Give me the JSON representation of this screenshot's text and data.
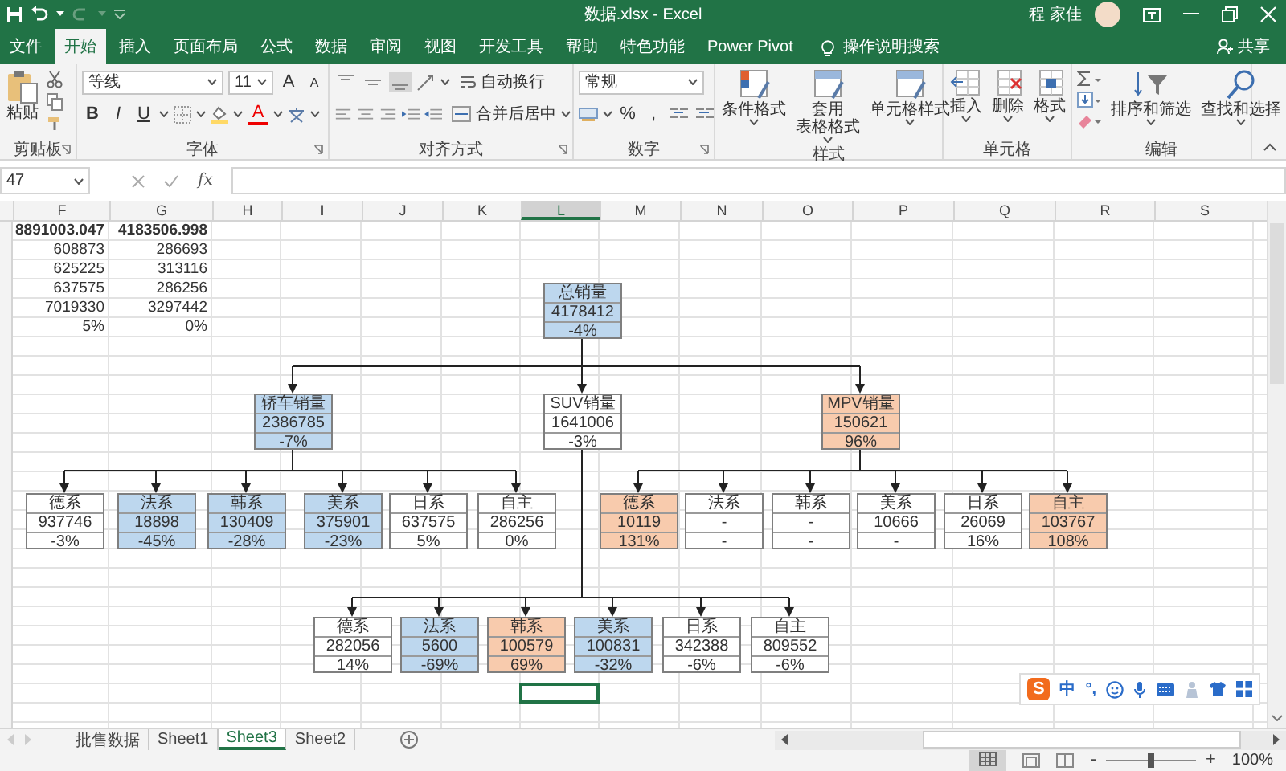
{
  "window": {
    "title": "数据.xlsx - Excel",
    "user": "程 家佳"
  },
  "ribbon_tabs": [
    {
      "label": "文件",
      "selected": false
    },
    {
      "label": "开始",
      "selected": true
    },
    {
      "label": "插入",
      "selected": false
    },
    {
      "label": "页面布局",
      "selected": false
    },
    {
      "label": "公式",
      "selected": false
    },
    {
      "label": "数据",
      "selected": false
    },
    {
      "label": "审阅",
      "selected": false
    },
    {
      "label": "视图",
      "selected": false
    },
    {
      "label": "开发工具",
      "selected": false
    },
    {
      "label": "帮助",
      "selected": false
    },
    {
      "label": "特色功能",
      "selected": false
    },
    {
      "label": "Power Pivot",
      "selected": false
    }
  ],
  "tell_me": "操作说明搜索",
  "share": "共享",
  "ribbon": {
    "clipboard": {
      "paste": "粘贴",
      "label": "剪贴板"
    },
    "font": {
      "name": "等线",
      "size": "11",
      "grow": "A",
      "shrink": "A",
      "styles": [
        "B",
        "I",
        "U"
      ],
      "color_button": "A",
      "label": "字体"
    },
    "alignment": {
      "wrap": "自动换行",
      "merge": "合并后居中",
      "label": "对齐方式"
    },
    "number": {
      "format": "常规",
      "percent": "%",
      "comma": ",",
      "label": "数字"
    },
    "styles": {
      "buttons": [
        {
          "lines": [
            "条件格式"
          ]
        },
        {
          "lines": [
            "套用",
            "表格格式"
          ]
        },
        {
          "lines": [
            "单元格样式"
          ]
        }
      ],
      "label": "样式"
    },
    "cells": {
      "buttons": [
        "插入",
        "删除",
        "格式"
      ],
      "label": "单元格"
    },
    "editing": {
      "buttons": [
        "排序和筛选",
        "查找和选择"
      ],
      "label": "编辑"
    }
  },
  "formula_bar": {
    "name_box": "47",
    "fx": "fx"
  },
  "columns": [
    {
      "label": "F",
      "selected": false
    },
    {
      "label": "G",
      "selected": false
    },
    {
      "label": "H",
      "selected": false
    },
    {
      "label": "I",
      "selected": false
    },
    {
      "label": "J",
      "selected": false
    },
    {
      "label": "K",
      "selected": false
    },
    {
      "label": "L",
      "selected": true
    },
    {
      "label": "M",
      "selected": false
    },
    {
      "label": "N",
      "selected": false
    },
    {
      "label": "O",
      "selected": false
    },
    {
      "label": "P",
      "selected": false
    },
    {
      "label": "Q",
      "selected": false
    },
    {
      "label": "R",
      "selected": false
    },
    {
      "label": "S",
      "selected": false
    }
  ],
  "cells": [
    {
      "f": "8891003.047",
      "g": "4183506.998",
      "bold": true
    },
    {
      "f": "608873",
      "g": "286693",
      "bold": false
    },
    {
      "f": "625225",
      "g": "313116",
      "bold": false
    },
    {
      "f": "637575",
      "g": "286256",
      "bold": false
    },
    {
      "f": "7019330",
      "g": "3297442",
      "bold": false
    },
    {
      "f": "5%",
      "g": "0%",
      "bold": false
    }
  ],
  "tree": {
    "label": "总销量",
    "value": "4178412",
    "change": "-4%",
    "color": "#bdd7ee",
    "children": [
      {
        "label": "轿车销量",
        "value": "2386785",
        "change": "-7%",
        "color": "#bdd7ee",
        "children": [
          {
            "label": "德系",
            "value": "937746",
            "change": "-3%",
            "color": "#ffffff"
          },
          {
            "label": "法系",
            "value": "18898",
            "change": "-45%",
            "color": "#bdd7ee"
          },
          {
            "label": "韩系",
            "value": "130409",
            "change": "-28%",
            "color": "#bdd7ee"
          },
          {
            "label": "美系",
            "value": "375901",
            "change": "-23%",
            "color": "#bdd7ee"
          },
          {
            "label": "日系",
            "value": "637575",
            "change": "5%",
            "color": "#ffffff"
          },
          {
            "label": "自主",
            "value": "286256",
            "change": "0%",
            "color": "#ffffff"
          }
        ]
      },
      {
        "label": "SUV销量",
        "value": "1641006",
        "change": "-3%",
        "color": "#ffffff",
        "children": [
          {
            "label": "德系",
            "value": "282056",
            "change": "14%",
            "color": "#ffffff"
          },
          {
            "label": "法系",
            "value": "5600",
            "change": "-69%",
            "color": "#bdd7ee"
          },
          {
            "label": "韩系",
            "value": "100579",
            "change": "69%",
            "color": "#f8cbad"
          },
          {
            "label": "美系",
            "value": "100831",
            "change": "-32%",
            "color": "#bdd7ee"
          },
          {
            "label": "日系",
            "value": "342388",
            "change": "-6%",
            "color": "#ffffff"
          },
          {
            "label": "自主",
            "value": "809552",
            "change": "-6%",
            "color": "#ffffff"
          }
        ]
      },
      {
        "label": "MPV销量",
        "value": "150621",
        "change": "96%",
        "color": "#f8cbad",
        "children": [
          {
            "label": "德系",
            "value": "10119",
            "change": "131%",
            "color": "#f8cbad"
          },
          {
            "label": "法系",
            "value": "-",
            "change": "-",
            "color": "#ffffff"
          },
          {
            "label": "韩系",
            "value": "-",
            "change": "-",
            "color": "#ffffff"
          },
          {
            "label": "美系",
            "value": "10666",
            "change": "-",
            "color": "#ffffff"
          },
          {
            "label": "日系",
            "value": "26069",
            "change": "16%",
            "color": "#ffffff"
          },
          {
            "label": "自主",
            "value": "103767",
            "change": "108%",
            "color": "#f8cbad"
          }
        ]
      }
    ]
  },
  "ime_toolbar": {
    "logo": "S",
    "mode": "中",
    "punctuation": "°,"
  },
  "sheet_tabs": [
    {
      "label": "批售数据",
      "selected": false
    },
    {
      "label": "Sheet1",
      "selected": false
    },
    {
      "label": "Sheet3",
      "selected": true
    },
    {
      "label": "Sheet2",
      "selected": false
    }
  ],
  "status_bar": {
    "zoom_out": "-",
    "zoom_in": "+",
    "zoom": "100%",
    "zoom_slider": {
      "level": 0.5
    }
  }
}
